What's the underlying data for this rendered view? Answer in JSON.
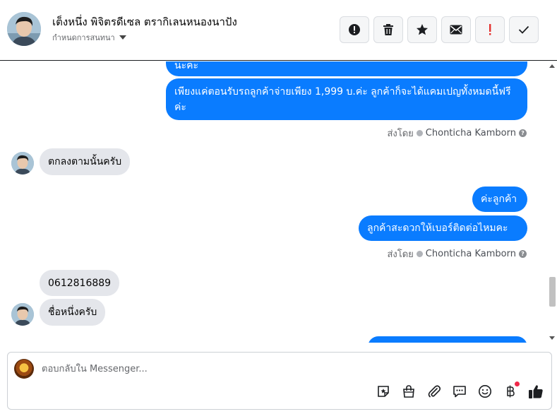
{
  "header": {
    "contact_name": "เต็งหนึ่ง พิจิตรดีเซล ตรากิเลนหนองนาปัง",
    "assign_label": "กำหนดการสนทนา",
    "actions": [
      {
        "icon": "alert-circle-icon",
        "name": "mark-spam-button"
      },
      {
        "icon": "trash-icon",
        "name": "delete-button"
      },
      {
        "icon": "star-icon",
        "name": "star-button"
      },
      {
        "icon": "envelope-icon",
        "name": "mark-unread-button"
      },
      {
        "icon": "exclamation-icon",
        "name": "follow-up-button"
      },
      {
        "icon": "check-icon",
        "name": "mark-done-button"
      }
    ]
  },
  "messages": {
    "out1_partial": "นะคะ",
    "out2": "เพียงแค่ตอนรับรถลูกค้าจ่ายเพียง 1,999 บ.ค่ะ ลูกค้าก็จะได้แคมเปญทั้งหมดนี้ฟรีค่ะ",
    "sent_by_label": "ส่งโดย",
    "sender_name": "Chonticha Kamborn",
    "in1": "ตกลงตามนั้นครับ",
    "out3": "ค่ะลูกค้า",
    "out4": "ลูกค้าสะดวกให้เบอร์ติดต่อไหมคะ",
    "in2": "0612816889",
    "in3": "ชื่อหนึ่งครับ"
  },
  "composer": {
    "placeholder": "ตอบกลับใน Messenger...",
    "tools": [
      "sticker-icon",
      "shopping-bag-icon",
      "paperclip-icon",
      "chat-bubble-icon",
      "emoji-icon",
      "currency-icon",
      "like-icon"
    ]
  },
  "colors": {
    "outgoing_bubble": "#0a7cff",
    "incoming_bubble": "#e4e6eb",
    "notification_dot": "#f02849"
  }
}
